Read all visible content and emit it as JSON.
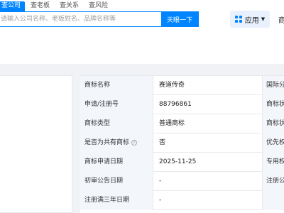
{
  "tabs": [
    "查公司",
    "查老板",
    "查关系",
    "查风险"
  ],
  "search": {
    "placeholder": "请输入公司名称、老板姓名、品牌名称等",
    "button": "天眼一下"
  },
  "header": {
    "app_label": "应用",
    "right_text": "商"
  },
  "table": {
    "rows": [
      {
        "label": "商标名称",
        "value": "赛道传奇",
        "label2": "国际分"
      },
      {
        "label": "申请/注册号",
        "value": "88796861",
        "label2": "商标状"
      },
      {
        "label": "商标类型",
        "value": "普通商标",
        "label2": "商标状"
      },
      {
        "label": "是否为共有商标",
        "value": "否",
        "label2": "优先权"
      },
      {
        "label": "商标申请日期",
        "value": "2025-11-25",
        "label2": "专用权"
      },
      {
        "label": "初审公告日期",
        "value": "-",
        "label2": "注册公"
      },
      {
        "label": "注册满三年日期",
        "value": "-",
        "label2": ""
      }
    ]
  },
  "colors": {
    "accent": "#0084ff",
    "label_bg": "#f3f6fb",
    "page_bg": "#f0f2f6"
  }
}
